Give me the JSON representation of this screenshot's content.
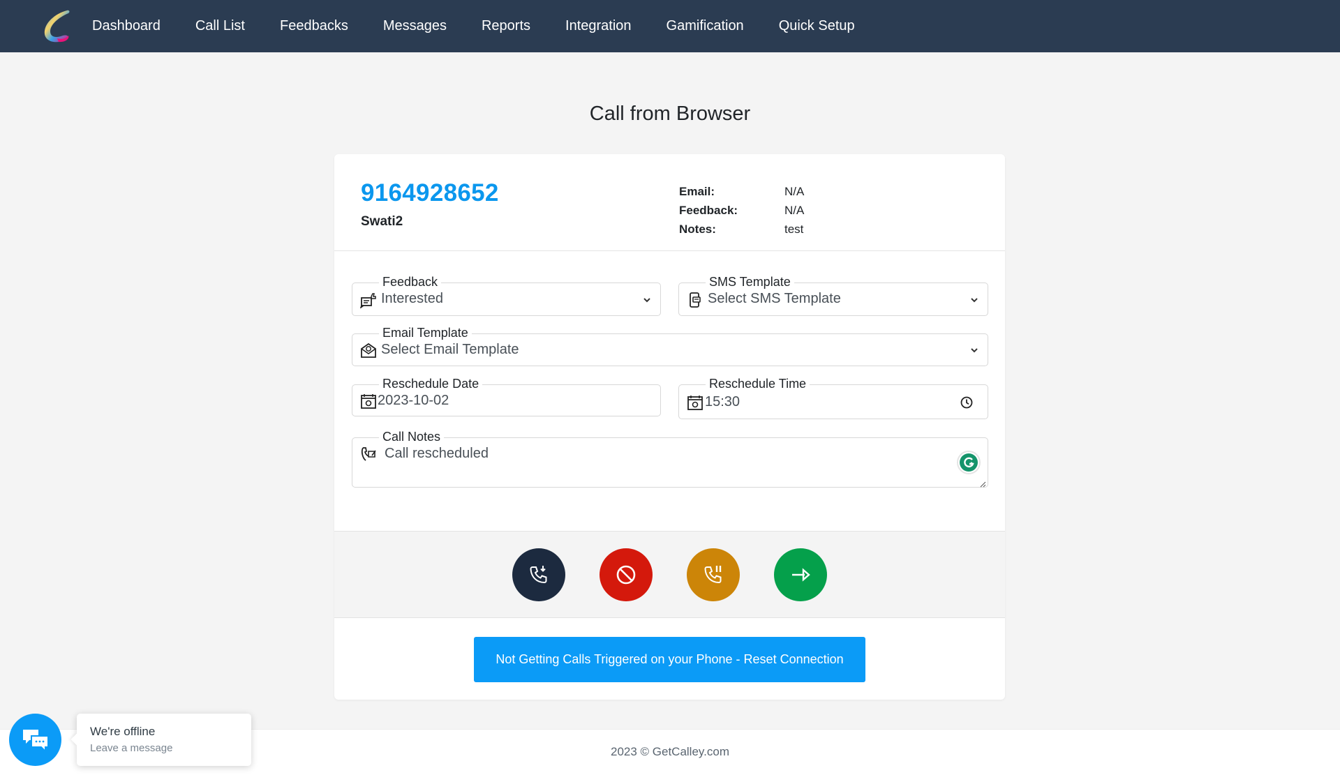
{
  "nav": {
    "items": [
      {
        "label": "Dashboard"
      },
      {
        "label": "Call List"
      },
      {
        "label": "Feedbacks"
      },
      {
        "label": "Messages"
      },
      {
        "label": "Reports"
      },
      {
        "label": "Integration"
      },
      {
        "label": "Gamification"
      },
      {
        "label": "Quick Setup"
      }
    ],
    "icons": [
      "android-icon",
      "apple-icon",
      "lifebuoy-icon",
      "search-icon",
      "bell-icon",
      "user-circle-icon"
    ]
  },
  "page": {
    "title": "Call from Browser"
  },
  "contact": {
    "phone": "9164928652",
    "name": "Swati2",
    "info": [
      {
        "label": "Email:",
        "value": "N/A"
      },
      {
        "label": "Feedback:",
        "value": "N/A"
      },
      {
        "label": "Notes:",
        "value": "test"
      }
    ]
  },
  "form": {
    "feedback": {
      "label": "Feedback",
      "value": "Interested"
    },
    "sms_template": {
      "label": "SMS Template",
      "value": "Select SMS Template"
    },
    "email_template": {
      "label": "Email Template",
      "value": "Select Email Template"
    },
    "reschedule_date": {
      "label": "Reschedule Date",
      "value": "2023-10-02"
    },
    "reschedule_time": {
      "label": "Reschedule Time",
      "value": "15:30"
    },
    "call_notes": {
      "label": "Call Notes",
      "value": "Call rescheduled"
    }
  },
  "actions": {
    "buttons": [
      {
        "name": "call-incoming-button",
        "color": "#1c2a3f"
      },
      {
        "name": "block-button",
        "color": "#d4190c"
      },
      {
        "name": "call-hold-button",
        "color": "#cc8508"
      },
      {
        "name": "next-button",
        "color": "#05a04b"
      }
    ],
    "reset_label": "Not Getting Calls Triggered on your Phone - Reset Connection"
  },
  "footer": {
    "text": "2023 © GetCalley.com"
  },
  "chat": {
    "title": "We're offline",
    "subtitle": "Leave a message"
  },
  "colors": {
    "nav_bg": "#2b3c52",
    "accent": "#0b97ee"
  }
}
